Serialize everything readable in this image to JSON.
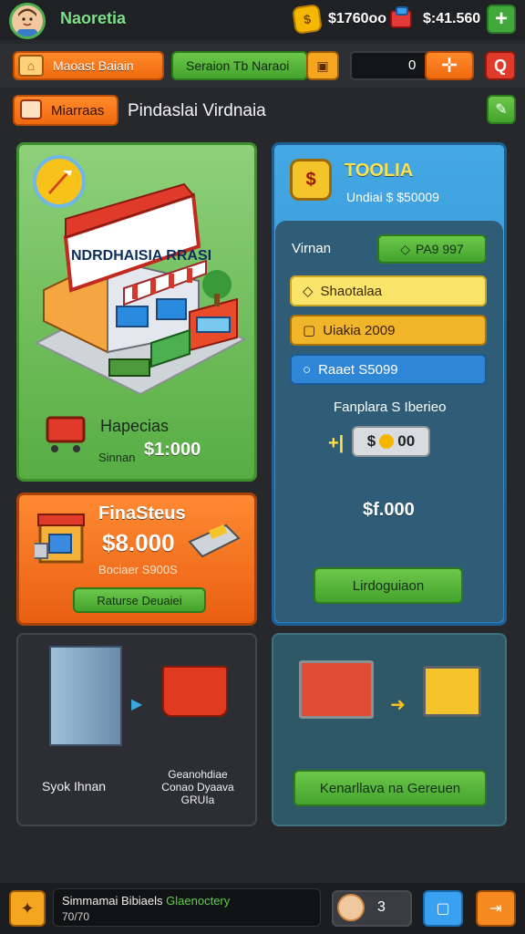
{
  "header": {
    "player_name": "Naoretia",
    "currency_1": "$1760oo",
    "currency_2": "$:41.560",
    "coin_icon": "coin-icon",
    "gem_icon": "gem-icon",
    "plus_label": "+"
  },
  "toolbar": {
    "home_label": "Maoast Baiain",
    "section_label": "Seraion Tb Naraoi",
    "input_value": "0",
    "cross_label": "✛",
    "q_label": "Q"
  },
  "titlebar": {
    "mission_label": "Miarraas",
    "page_title": "Pindaslai Virdnaia"
  },
  "store_card": {
    "sign_text": "NDRDHAISIA RRASI",
    "label": "Hapecias",
    "sub": "Sinnan",
    "price": "$1:000"
  },
  "finance_card": {
    "title": "FinaSteus",
    "amount": "$8.000",
    "sub": "Bociaer S900S",
    "button_label": "Raturse Deuaiei"
  },
  "blue_card": {
    "title": "TOOLIA",
    "subtitle": "Undiai $ $50009",
    "vitrina_label": "Virnan",
    "vitrina_value": "PA9 997",
    "options": [
      {
        "label": "Shaotalaa"
      },
      {
        "label": "Uiakia 2009"
      },
      {
        "label": "Raaet S5099"
      }
    ],
    "compare_label": "Fanplara S Iberieo",
    "qty_value": "00",
    "qty_prefix": "$",
    "total": "$f.000",
    "cta_label": "Lirdoguiaon"
  },
  "dark_card": {
    "left_label": "Syok Ihnan",
    "right_label": "Geanohdiae Conao Dyaava GRUIa"
  },
  "teal_card": {
    "cta_label": "Kenarllava na Gereuen"
  },
  "bottombar": {
    "message_prefix": "Simmamai Bibiaels",
    "message_green": "Glaenoctery",
    "message_line2": "70/70",
    "count": "3"
  },
  "colors": {
    "accent_green": "#4caf50",
    "accent_orange": "#f06a10",
    "accent_blue": "#2b7fc0",
    "bg": "#26282c"
  }
}
